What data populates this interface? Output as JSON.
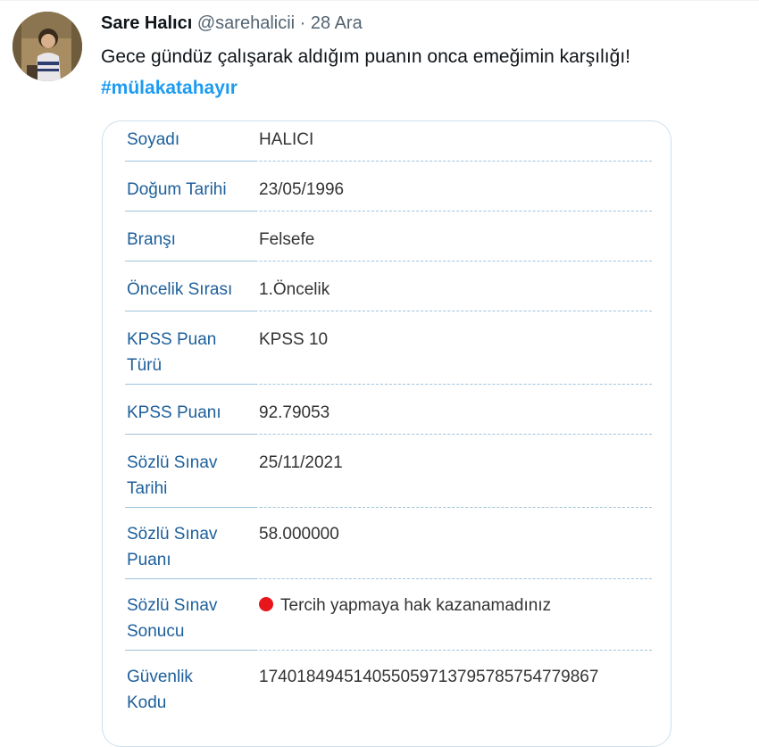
{
  "tweet": {
    "author_name": "Sare Halıcı",
    "author_handle": "@sarehalicii",
    "separator": "·",
    "date": "28 Ara",
    "text": "Gece gündüz çalışarak aldığım puanın onca emeğimin karşılığı!",
    "hashtag": "#mülakatahayır",
    "avatar_icon": "profile-photo"
  },
  "result_card": {
    "rows": [
      {
        "label": "Soyadı",
        "value": "HALICI"
      },
      {
        "label": "Doğum Tarihi",
        "value": "23/05/1996"
      },
      {
        "label": "Branşı",
        "value": "Felsefe"
      },
      {
        "label": "Öncelik Sırası",
        "value": "1.Öncelik"
      },
      {
        "label": "KPSS Puan Türü",
        "value": "KPSS 10"
      },
      {
        "label": "KPSS Puanı",
        "value": "92.79053"
      },
      {
        "label": "Sözlü Sınav Tarihi",
        "value": "25/11/2021"
      },
      {
        "label": "Sözlü Sınav Puanı",
        "value": "58.000000"
      },
      {
        "label": "Sözlü Sınav Sonucu",
        "value": "Tercih yapmaya hak kazanamadınız"
      },
      {
        "label": "Güvenlik Kodu",
        "value": "17401849451405505971379578575477986 7"
      }
    ],
    "status_color": "#e8161b",
    "label_color": "#1d5f9b"
  }
}
